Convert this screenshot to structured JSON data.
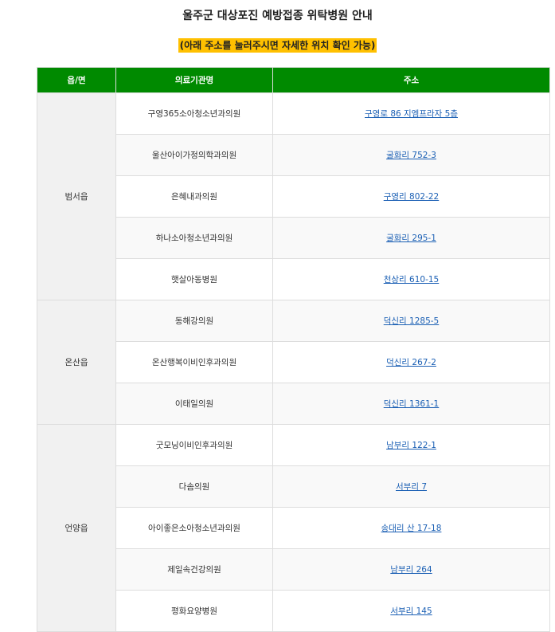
{
  "title": "울주군 대상포진 예방접종 위탁병원 안내",
  "note": "(아래 주소를 눌러주시면 자세한 위치 확인 가능)",
  "colors": {
    "header_bg": "#008a00",
    "note_bg": "#ffc000",
    "link": "#1a5fb4"
  },
  "table": {
    "headers": [
      "읍/면",
      "의료기관명",
      "주소"
    ],
    "groups": [
      {
        "region": "범서읍",
        "rows": [
          {
            "name": "구영365소아청소년과의원",
            "address": "구영로 86 지엠프라자 5층"
          },
          {
            "name": "울산아이가정의학과의원",
            "address": "굴화리 752-3"
          },
          {
            "name": "은혜내과의원",
            "address": "구영리 802-22"
          },
          {
            "name": "하나소아청소년과의원",
            "address": "굴화리 295-1"
          },
          {
            "name": "햇살아동병원",
            "address": "천상리 610-15"
          }
        ]
      },
      {
        "region": "온산읍",
        "rows": [
          {
            "name": "동해강의원",
            "address": "덕신리 1285-5"
          },
          {
            "name": "온산행복이비인후과의원",
            "address": "덕신리 267-2"
          },
          {
            "name": "이태일의원",
            "address": "덕신리 1361-1"
          }
        ]
      },
      {
        "region": "언양읍",
        "rows": [
          {
            "name": "굿모닝이비인후과의원",
            "address": "남부리 122-1"
          },
          {
            "name": "다솜의원",
            "address": "서부리 7"
          },
          {
            "name": "아이좋은소아청소년과의원",
            "address": "송대리 산 17-18"
          },
          {
            "name": "제일속건강의원",
            "address": "남부리 264"
          },
          {
            "name": "평화요양병원",
            "address": "서부리 145"
          }
        ]
      }
    ]
  }
}
